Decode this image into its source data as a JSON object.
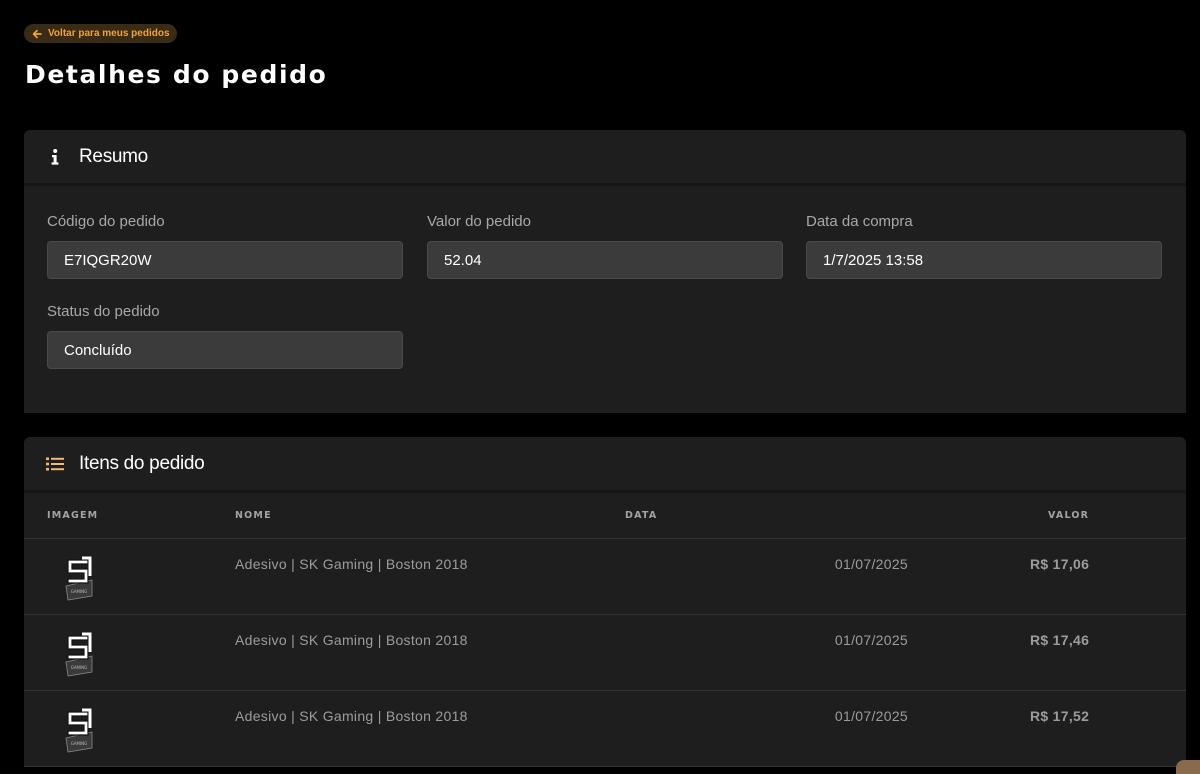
{
  "nav": {
    "back_label": "Voltar para meus pedidos"
  },
  "page": {
    "title": "Detalhes do pedido"
  },
  "summary": {
    "title": "Resumo",
    "icon": "info-icon",
    "fields": {
      "order_code": {
        "label": "Código do pedido",
        "value": "E7IQGR20W"
      },
      "order_value": {
        "label": "Valor do pedido",
        "value": "52.04"
      },
      "purchase_date": {
        "label": "Data da compra",
        "value": "1/7/2025 13:58"
      },
      "order_status": {
        "label": "Status do pedido",
        "value": "Concluído"
      }
    }
  },
  "items": {
    "title": "Itens do pedido",
    "icon": "list-icon",
    "columns": {
      "image": "IMAGEM",
      "name": "NOME",
      "date": "DATA",
      "value": "VALOR"
    },
    "rows": [
      {
        "image_icon": "sk-gaming-sticker-icon",
        "name": "Adesivo | SK Gaming | Boston 2018",
        "date": "01/07/2025",
        "value": "R$ 17,06"
      },
      {
        "image_icon": "sk-gaming-sticker-icon",
        "name": "Adesivo | SK Gaming | Boston 2018",
        "date": "01/07/2025",
        "value": "R$ 17,46"
      },
      {
        "image_icon": "sk-gaming-sticker-icon",
        "name": "Adesivo | SK Gaming | Boston 2018",
        "date": "01/07/2025",
        "value": "R$ 17,52"
      }
    ]
  },
  "colors": {
    "background": "#000000",
    "card": "#1e1e1e",
    "input": "#3b3b3b",
    "accent": "#f0a33a",
    "accent_bg": "#3a2b17",
    "icon_accent": "#f2b77a"
  }
}
